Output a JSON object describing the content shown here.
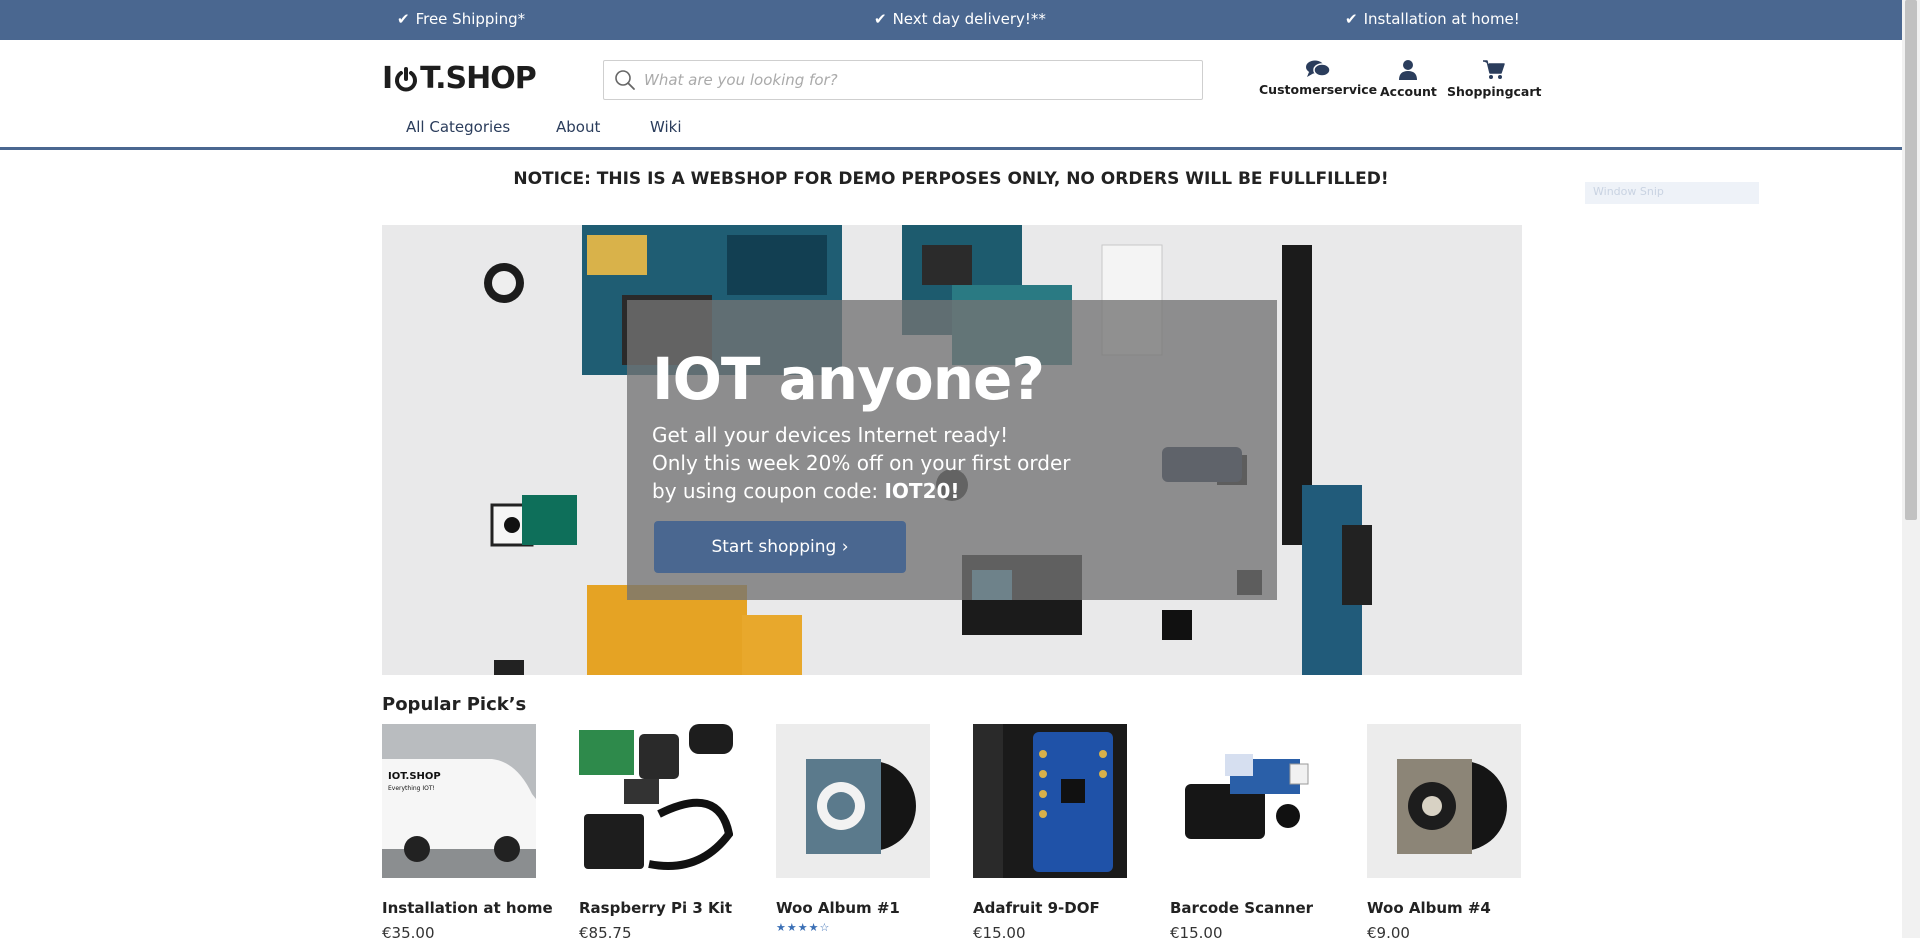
{
  "topbar": {
    "usps": [
      "Free Shipping*",
      "Next day delivery!**",
      "Installation at home!"
    ],
    "bg": "#4a6790"
  },
  "header": {
    "logo_pre": "I",
    "logo_post": "T.SHOP",
    "search_placeholder": "What are you looking for?",
    "links": [
      "Customerservice",
      "Account",
      "Shoppingcart"
    ],
    "nav": [
      "All Categories",
      "About",
      "Wiki"
    ]
  },
  "notice": "NOTICE: THIS IS A WEBSHOP FOR DEMO PERPOSES ONLY, NO ORDERS WILL BE FULLFILLED!",
  "ghost": "Window Snip",
  "hero": {
    "title": "IOT anyone?",
    "line1": "Get all your devices Internet ready!",
    "line2": "Only this week 20% off on your first order",
    "line3_pre": "by using coupon code: ",
    "coupon": "IOT20!",
    "cta": "Start shopping"
  },
  "popular": {
    "title": "Popular Pick’s",
    "products": [
      {
        "name": "Installation at home",
        "price": "€35.00",
        "image": "van"
      },
      {
        "name": "Raspberry Pi 3 Kit",
        "price": "€85.75",
        "image": "pi-kit"
      },
      {
        "name": "Woo Album #1",
        "price": "",
        "rating": 4,
        "image": "album-blue"
      },
      {
        "name": "Adafruit 9-DOF",
        "price": "€15.00",
        "image": "sensor-board"
      },
      {
        "name": "Barcode Scanner",
        "price": "€15.00",
        "image": "scanner"
      },
      {
        "name": "Woo Album #4",
        "price": "€9.00",
        "image": "album-grey"
      }
    ]
  }
}
